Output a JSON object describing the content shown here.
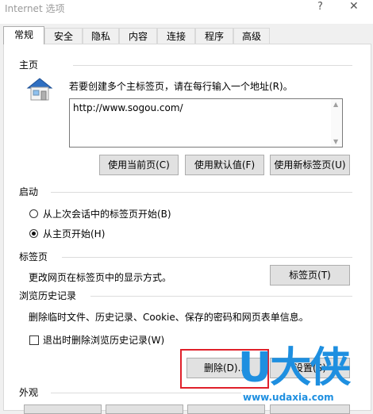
{
  "window": {
    "title": "Internet 选项",
    "help": "?",
    "close": "✕"
  },
  "tabs": [
    {
      "label": "常规",
      "active": true
    },
    {
      "label": "安全"
    },
    {
      "label": "隐私"
    },
    {
      "label": "内容"
    },
    {
      "label": "连接"
    },
    {
      "label": "程序"
    },
    {
      "label": "高级"
    }
  ],
  "home": {
    "title": "主页",
    "instruction": "若要创建多个主标签页，请在每行输入一个地址(R)。",
    "url": "http://www.sogou.com/",
    "btn_current": "使用当前页(C)",
    "btn_default": "使用默认值(F)",
    "btn_newtab": "使用新标签页(U)"
  },
  "startup": {
    "title": "启动",
    "option_last_session": "从上次会话中的标签页开始(B)",
    "option_home": "从主页开始(H)",
    "selected": "home"
  },
  "tabs_group": {
    "title": "标签页",
    "desc": "更改网页在标签页中的显示方式。",
    "btn": "标签页(T)"
  },
  "history": {
    "title": "浏览历史记录",
    "desc": "删除临时文件、历史记录、Cookie、保存的密码和网页表单信息。",
    "checkbox_label": "退出时删除浏览历史记录(W)",
    "checkbox_checked": false,
    "btn_delete": "删除(D)...",
    "btn_settings": "设置(S)"
  },
  "appearance": {
    "title": "外观"
  },
  "watermark": {
    "logo": "U大侠",
    "url": "www.udaxia.com"
  },
  "colors": {
    "highlight": "#e0202a",
    "watermark": "#1e8fe0"
  }
}
